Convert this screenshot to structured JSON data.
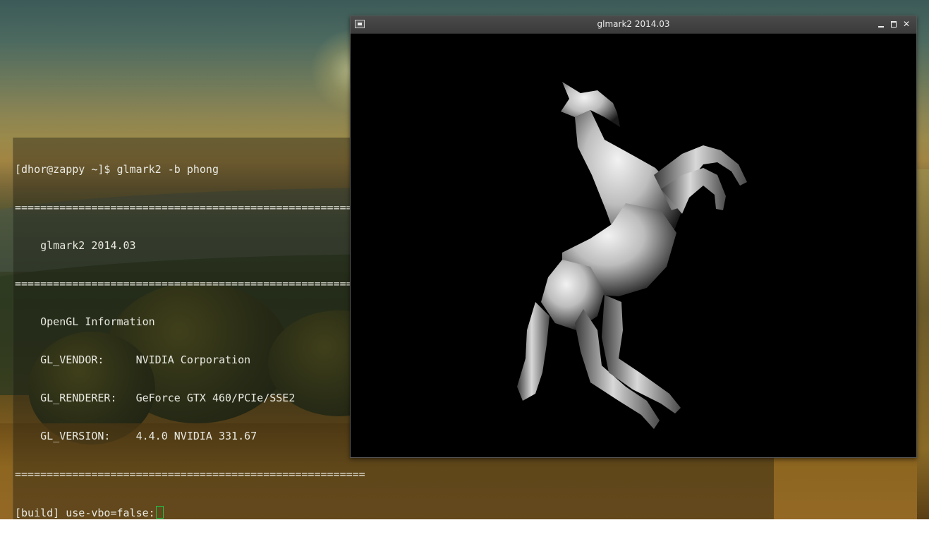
{
  "terminal": {
    "lines": [
      "[dhor@zappy ~]$ glmark2 -b phong",
      "=======================================================",
      "    glmark2 2014.03",
      "=======================================================",
      "    OpenGL Information",
      "    GL_VENDOR:     NVIDIA Corporation",
      "    GL_RENDERER:   GeForce GTX 460/PCIe/SSE2",
      "    GL_VERSION:    4.4.0 NVIDIA 331.67",
      "======================================================="
    ],
    "prompt_line": "[build] use-vbo=false:"
  },
  "gl_window": {
    "title": "glmark2 2014.03",
    "menu_icon": "window-menu-icon",
    "minimize_icon": "minimize-icon",
    "maximize_icon": "maximize-icon",
    "close_label": "✕"
  },
  "colors": {
    "terminal_text": "#e8e8e0",
    "cursor": "#22c24a",
    "titlebar": "#3a3a3a",
    "render_bg": "#000000"
  }
}
